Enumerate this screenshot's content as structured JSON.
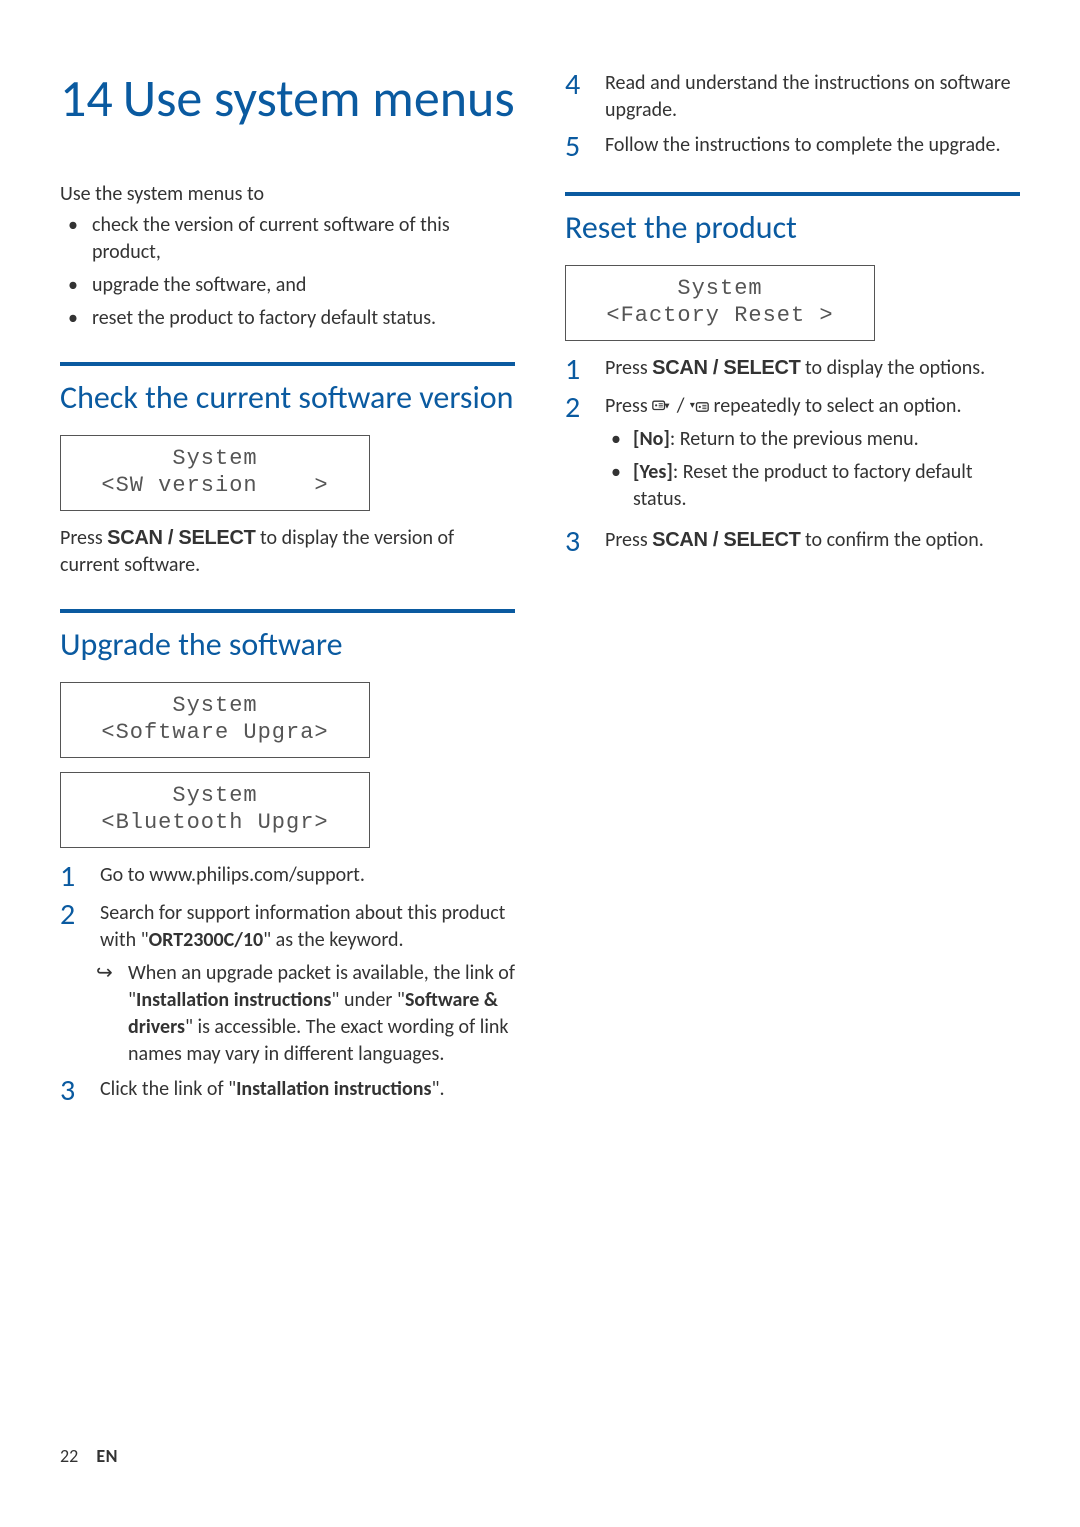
{
  "chapter": {
    "number": "14",
    "title": "Use system menus"
  },
  "left": {
    "intro": "Use the system menus to",
    "intro_bullets": [
      "check the version of current software of this product,",
      "upgrade the software, and",
      "reset the product to factory default status."
    ],
    "sec_check": {
      "heading": "Check the current software version",
      "lcd": {
        "l1": "System",
        "l2": "<SW version    >"
      },
      "para_a": "Press ",
      "para_b": " to display the version of current software.",
      "scan_select": "SCAN / SELECT"
    },
    "sec_upgrade": {
      "heading": "Upgrade the software",
      "lcd1": {
        "l1": "System",
        "l2": "<Software Upgra>"
      },
      "lcd2": {
        "l1": "System",
        "l2": "<Bluetooth Upgr>"
      },
      "steps": {
        "s1": "Go to www.philips.com/support.",
        "s2a": "Search for support information about this product with \"",
        "s2_kw": "ORT2300C/10",
        "s2b": "\" as the keyword.",
        "s2_arrow_a": "When an upgrade packet is available, the link of \"",
        "s2_arrow_kw1": "Installation instructions",
        "s2_arrow_b": "\" under \"",
        "s2_arrow_kw2": "Software & drivers",
        "s2_arrow_c": "\" is accessible. The exact wording of link names may vary in different languages.",
        "s3a": "Click the link of \"",
        "s3_kw": "Installation instructions",
        "s3b": "\"."
      }
    }
  },
  "right": {
    "cont_steps": {
      "s4": "Read and understand the instructions on software upgrade.",
      "s5": "Follow the instructions to complete the upgrade."
    },
    "sec_reset": {
      "heading": "Reset the product",
      "lcd": {
        "l1": "System",
        "l2": "<Factory Reset >"
      },
      "s1a": "Press ",
      "s1b": " to display the options.",
      "scan_select": "SCAN / SELECT",
      "s2a": "Press ",
      "s2b": " repeatedly to select an option.",
      "s2_opts": {
        "no_label": "[No]",
        "no_text": ": Return to the previous menu.",
        "yes_label": "[Yes]",
        "yes_text": ": Reset the product to factory default status."
      },
      "s3a": "Press ",
      "s3b": " to confirm the option."
    }
  },
  "footer": {
    "page": "22",
    "lang": "EN"
  }
}
